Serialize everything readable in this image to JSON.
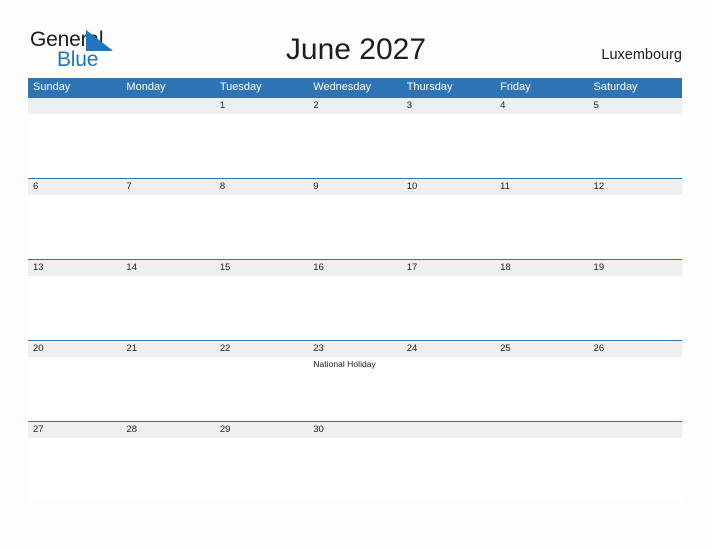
{
  "brand": {
    "name_part1": "General",
    "name_part2": "Blue",
    "flag_icon": "triangle-flag-icon",
    "accent_color": "#2175bd"
  },
  "header": {
    "title": "June 2027",
    "country": "Luxembourg"
  },
  "theme": {
    "header_blue": "#2e74b5",
    "row_band_gray": "#efefef",
    "page_background": "#fdfdfe",
    "text_color": "#1d1d1d"
  },
  "calendar": {
    "month": "June",
    "year": "2027",
    "weekday_headers": [
      "Sunday",
      "Monday",
      "Tuesday",
      "Wednesday",
      "Thursday",
      "Friday",
      "Saturday"
    ],
    "weeks": [
      {
        "days": [
          {
            "date": "",
            "events": []
          },
          {
            "date": "",
            "events": []
          },
          {
            "date": "1",
            "events": []
          },
          {
            "date": "2",
            "events": []
          },
          {
            "date": "3",
            "events": []
          },
          {
            "date": "4",
            "events": []
          },
          {
            "date": "5",
            "events": []
          }
        ]
      },
      {
        "days": [
          {
            "date": "6",
            "events": []
          },
          {
            "date": "7",
            "events": []
          },
          {
            "date": "8",
            "events": []
          },
          {
            "date": "9",
            "events": []
          },
          {
            "date": "10",
            "events": []
          },
          {
            "date": "11",
            "events": []
          },
          {
            "date": "12",
            "events": []
          }
        ]
      },
      {
        "days": [
          {
            "date": "13",
            "events": []
          },
          {
            "date": "14",
            "events": []
          },
          {
            "date": "15",
            "events": []
          },
          {
            "date": "16",
            "events": []
          },
          {
            "date": "17",
            "events": []
          },
          {
            "date": "18",
            "events": []
          },
          {
            "date": "19",
            "events": []
          }
        ]
      },
      {
        "days": [
          {
            "date": "20",
            "events": []
          },
          {
            "date": "21",
            "events": []
          },
          {
            "date": "22",
            "events": []
          },
          {
            "date": "23",
            "events": [
              "National Holiday"
            ]
          },
          {
            "date": "24",
            "events": []
          },
          {
            "date": "25",
            "events": []
          },
          {
            "date": "26",
            "events": []
          }
        ]
      },
      {
        "days": [
          {
            "date": "27",
            "events": []
          },
          {
            "date": "28",
            "events": []
          },
          {
            "date": "29",
            "events": []
          },
          {
            "date": "30",
            "events": []
          },
          {
            "date": "",
            "events": []
          },
          {
            "date": "",
            "events": []
          },
          {
            "date": "",
            "events": []
          }
        ]
      }
    ]
  }
}
